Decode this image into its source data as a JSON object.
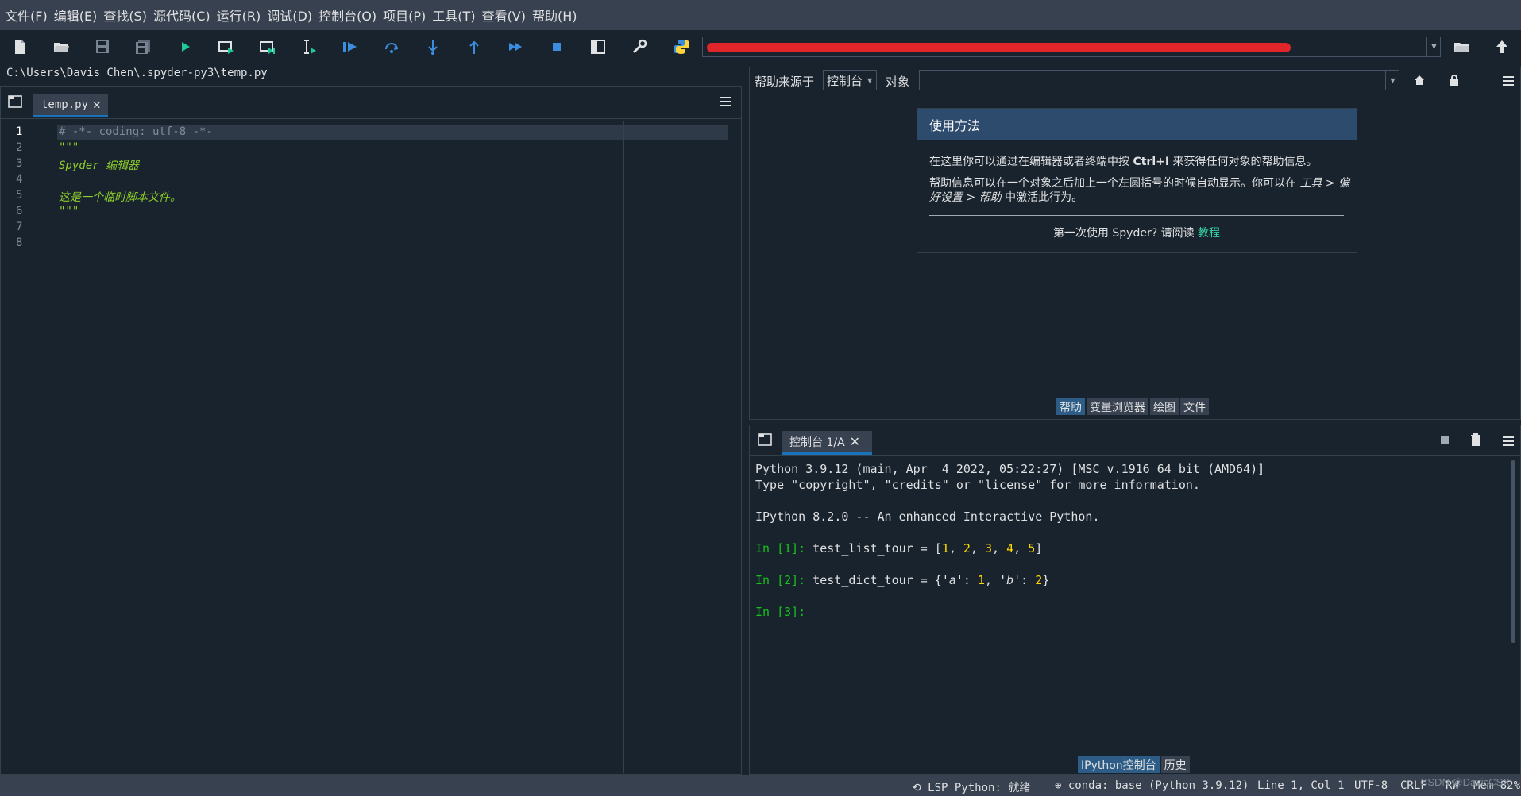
{
  "menubar": {
    "items": [
      "文件(F)",
      "编辑(E)",
      "查找(S)",
      "源代码(C)",
      "运行(R)",
      "调试(D)",
      "控制台(O)",
      "项目(P)",
      "工具(T)",
      "查看(V)",
      "帮助(H)"
    ]
  },
  "toolbar": {
    "icons": [
      "new-file-icon",
      "open-file-icon",
      "save-icon",
      "save-all-icon",
      "run-icon",
      "run-cell-icon",
      "run-cell-advance-icon",
      "run-selection-icon",
      "debug-icon",
      "step-over-icon",
      "step-into-icon",
      "step-out-icon",
      "continue-icon",
      "stop-icon",
      "maximize-pane-icon",
      "preferences-icon",
      "python-path-icon",
      "browse-directory-icon",
      "parent-directory-icon"
    ]
  },
  "editor": {
    "file_path": "C:\\Users\\Davis Chen\\.spyder-py3\\temp.py",
    "tab_label": "temp.py",
    "current_line": 1,
    "lines": [
      {
        "num": "1",
        "text": "# -*- coding: utf-8 -*-"
      },
      {
        "num": "2",
        "text": "\"\"\""
      },
      {
        "num": "3",
        "text": "Spyder 编辑器"
      },
      {
        "num": "4",
        "text": ""
      },
      {
        "num": "5",
        "text": "这是一个临时脚本文件。"
      },
      {
        "num": "6",
        "text": "\"\"\""
      },
      {
        "num": "7",
        "text": ""
      },
      {
        "num": "8",
        "text": ""
      }
    ]
  },
  "help": {
    "source_label": "帮助来源于",
    "source_value": "控制台",
    "object_label": "对象",
    "object_value": "",
    "usage_title": "使用方法",
    "usage_line1_pre": "在这里你可以通过在编辑器或者终端中按 ",
    "usage_line1_key": "Ctrl+I",
    "usage_line1_post": " 来获得任何对象的帮助信息。",
    "usage_line2_pre": "帮助信息可以在一个对象之后加上一个左圆括号的时候自动显示。你可以在 ",
    "usage_line2_path": "工具 > 偏好设置 > 帮助",
    "usage_line2_post": " 中激活此行为。",
    "first_time_pre": "第一次使用 Spyder? 请阅读 ",
    "first_time_link": "教程",
    "tabs": [
      "帮助",
      "变量浏览器",
      "绘图",
      "文件"
    ]
  },
  "console": {
    "tab_label": "控制台 1/A",
    "banner1": "Python 3.9.12 (main, Apr  4 2022, 05:22:27) [MSC v.1916 64 bit (AMD64)]",
    "banner2": "Type \"copyright\", \"credits\" or \"license\" for more information.",
    "banner3": "IPython 8.2.0 -- An enhanced Interactive Python.",
    "prompt1": "In [1]: ",
    "prompt2": "In [2]: ",
    "prompt3": "In [3]: ",
    "tabs": [
      "IPython控制台",
      "历史"
    ]
  },
  "statusbar": {
    "lsp": "LSP Python: 就绪",
    "conda": "conda: base (Python 3.9.12)",
    "position": "Line 1, Col 1",
    "encoding": "UTF-8",
    "eol": "CRLF",
    "perm": "RW",
    "mem": "Mem 82%"
  },
  "watermark": "CSDN @DavisCSX",
  "colors": {
    "background": "#19232d",
    "panel": "#37414f",
    "accent": "#1a72bb",
    "prompt_green": "#14c31b",
    "number_yellow": "#ffd700",
    "docstring_green": "#8fce2b",
    "link_teal": "#37d0a3",
    "redaction_red": "#e0262a"
  }
}
